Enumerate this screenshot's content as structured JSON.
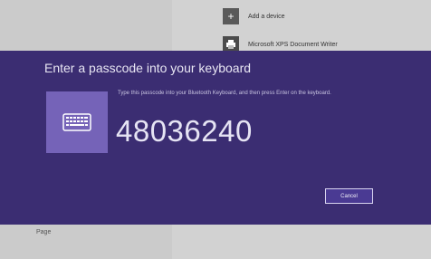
{
  "background": {
    "items": [
      {
        "label": "Add a device",
        "icon": "plus-icon"
      },
      {
        "label": "Microsoft XPS Document Writer",
        "icon": "printer-icon"
      }
    ],
    "bottom_text": "Page"
  },
  "dialog": {
    "title": "Enter a passcode into your keyboard",
    "instruction": "Type this passcode into your Bluetooth Keyboard, and then press Enter on the keyboard.",
    "passcode": "48036240",
    "cancel_label": "Cancel",
    "tile_icon": "keyboard-icon"
  },
  "colors": {
    "dialog_background": "#3b2d72",
    "tile": "#7563b8",
    "button_background": "#4a3a93",
    "page_background": "#d2d2d2"
  }
}
